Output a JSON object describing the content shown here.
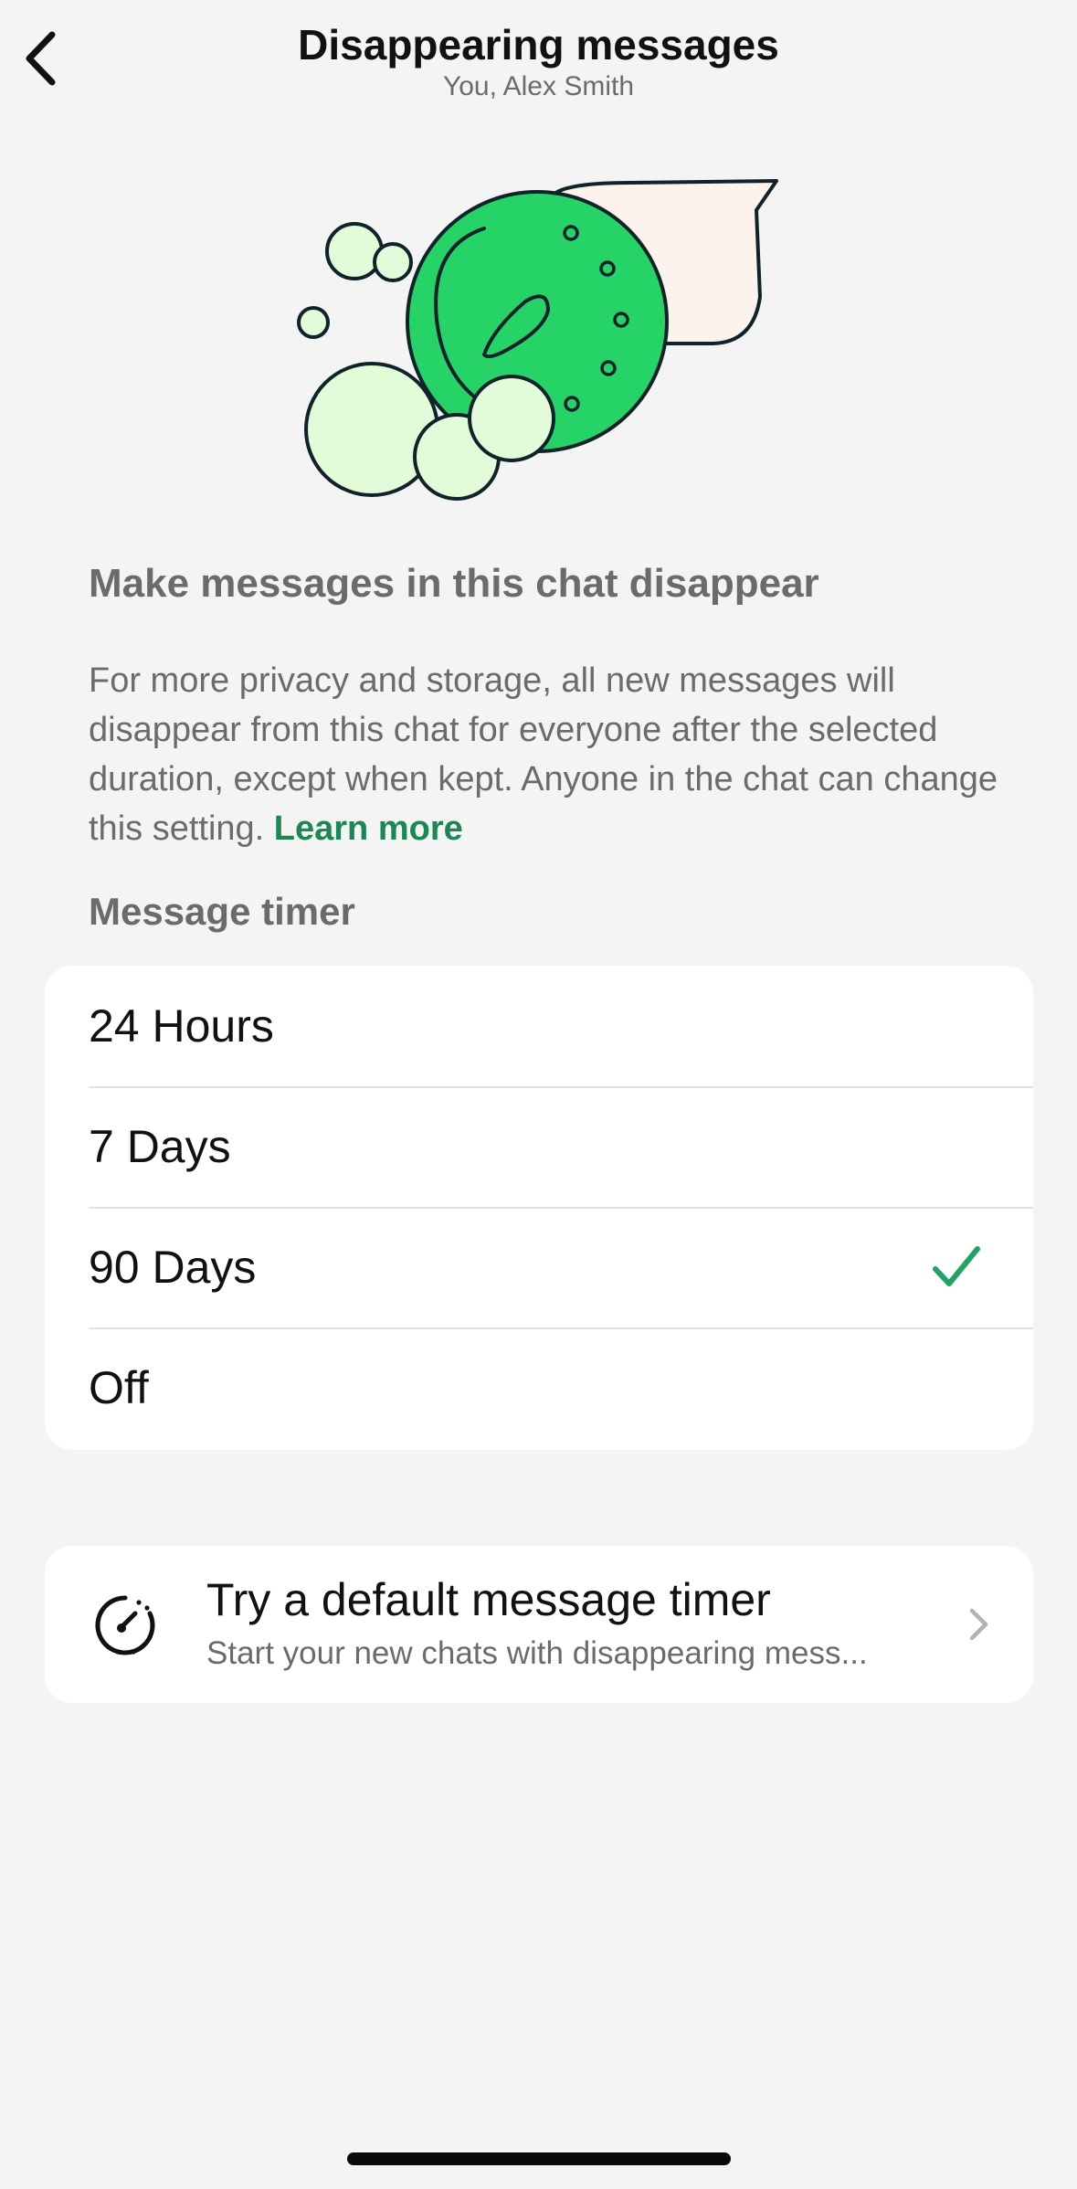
{
  "header": {
    "back_icon": "chevron-left-icon",
    "title": "Disappearing messages",
    "subtitle": "You, Alex Smith"
  },
  "illustration": {
    "name": "disappearing-timer-illustration",
    "colors": {
      "green": "#25d366",
      "light_green": "#e2fbd9",
      "bubble": "#fcf3ec",
      "outline": "#10232a"
    }
  },
  "info": {
    "heading": "Make messages in this chat disappear",
    "description": "For more privacy and storage, all new messages will disappear from this chat for everyone after the selected duration, except when kept. Anyone in the chat can change this setting.",
    "learn_more": "Learn more"
  },
  "timer": {
    "section_label": "Message timer",
    "options": [
      {
        "label": "24 Hours",
        "selected": false
      },
      {
        "label": "7 Days",
        "selected": false
      },
      {
        "label": "90 Days",
        "selected": true
      },
      {
        "label": "Off",
        "selected": false
      }
    ],
    "check_icon": "checkmark-icon"
  },
  "default_timer": {
    "icon": "timer-icon",
    "title": "Try a default message timer",
    "subtitle": "Start your new chats with disappearing mess...",
    "chevron_icon": "chevron-right-icon"
  },
  "colors": {
    "accent": "#1b8755",
    "check": "#21a366",
    "background": "#f4f4f4",
    "card": "#ffffff",
    "secondary_text": "#6b6b6b"
  }
}
